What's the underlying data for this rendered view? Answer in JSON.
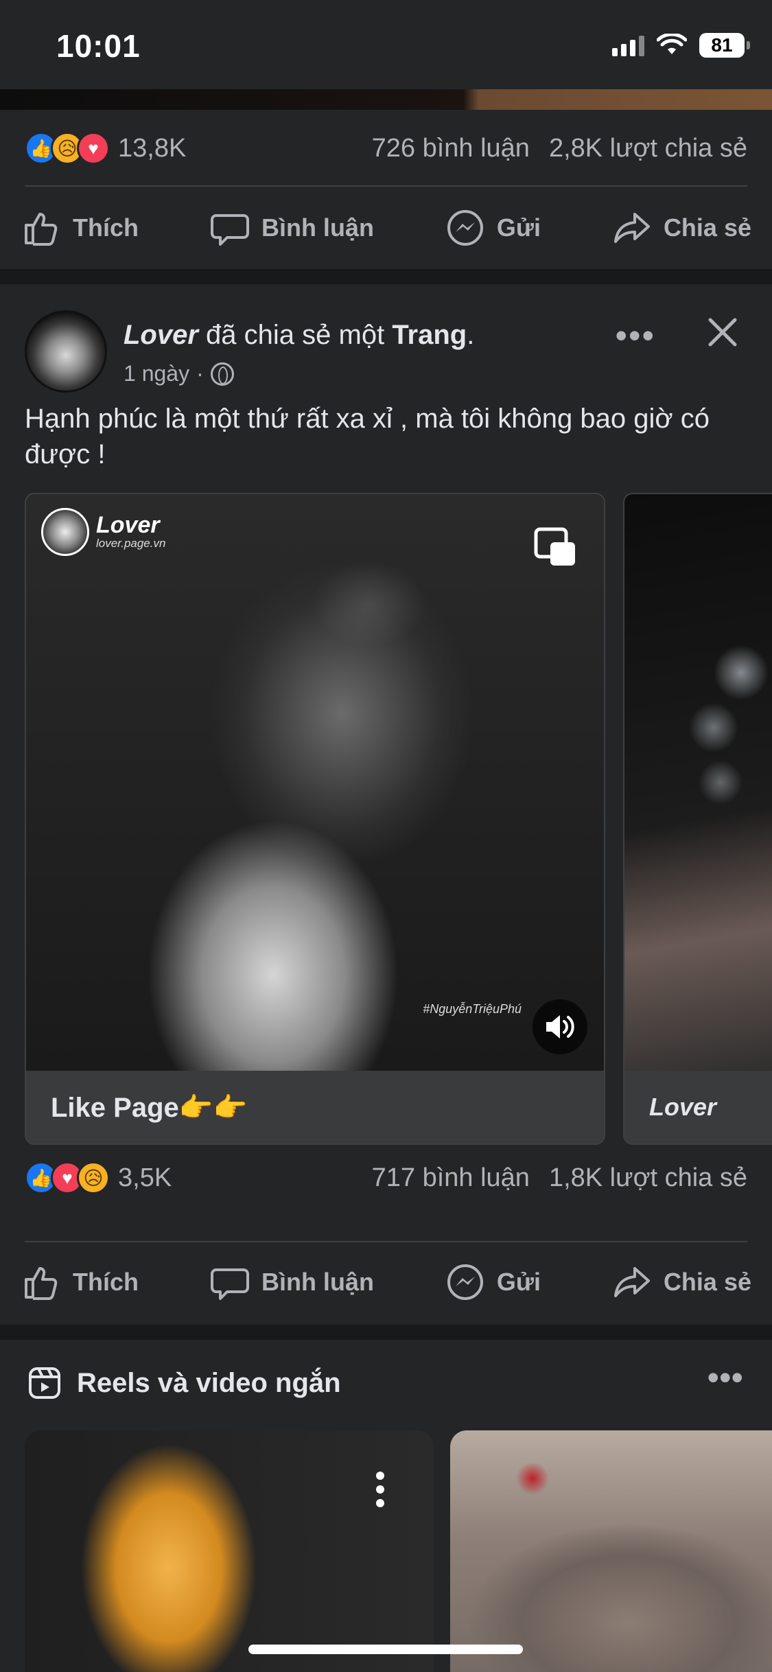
{
  "status_bar": {
    "time": "10:01",
    "battery": "81"
  },
  "prev_post": {
    "reaction_count": "13,8K",
    "comments": "726 bình luận",
    "shares": "2,8K lượt chia sẻ"
  },
  "actions": {
    "like": "Thích",
    "comment": "Bình luận",
    "send": "Gửi",
    "share": "Chia sẻ"
  },
  "post": {
    "author": "Lover",
    "title_middle": " đã chia sẻ một ",
    "title_object": "Trang",
    "title_end": ".",
    "time": "1 ngày",
    "dot": "·",
    "text": "Hạnh phúc là một thứ rất xa xỉ , mà tôi không bao giờ có được !",
    "slides": [
      {
        "caption": "Like Page👉👉",
        "page_name": "Lover",
        "page_url": "lover.page.vn",
        "watermark": "#NguyễnTriệuPhú"
      },
      {
        "caption": "Lover"
      }
    ],
    "reaction_count": "3,5K",
    "comments": "717 bình luận",
    "shares": "1,8K lượt chia sẻ"
  },
  "reels": {
    "title": "Reels và video ngắn"
  },
  "colors": {
    "background": "#18191a",
    "card": "#242526",
    "text": "#e4e6eb",
    "muted": "#b0b3b8",
    "like_blue": "#1877f2",
    "love_red": "#f33e58",
    "sad_yellow": "#f7b125"
  }
}
